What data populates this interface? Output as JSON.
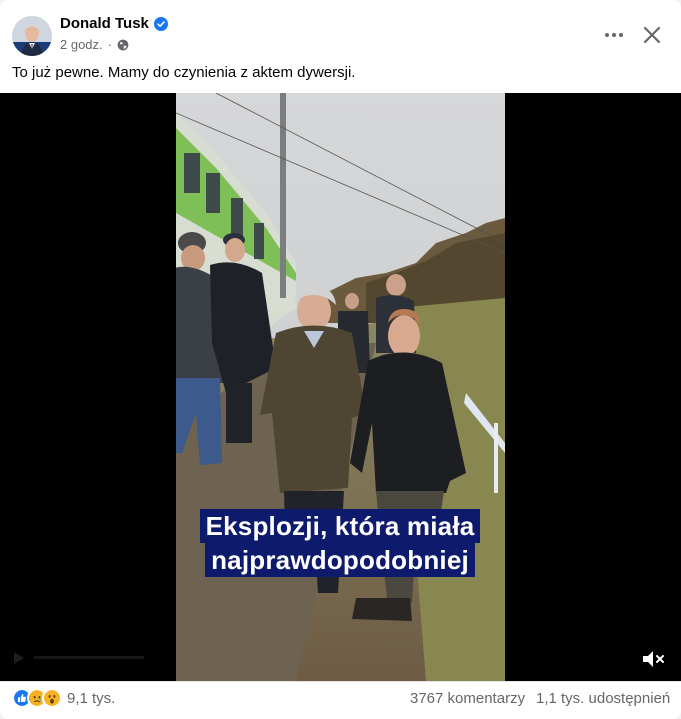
{
  "post": {
    "author": "Donald Tusk",
    "timestamp": "2 godz.",
    "separator": "·",
    "text": "To już pewne. Mamy do czynienia z aktem dywersji."
  },
  "video": {
    "subtitle_line1": "Eksplozji, która miała",
    "subtitle_line2": "najprawdopodobniej",
    "subtitle_bg": "#0e1a6b",
    "muted": true
  },
  "stats": {
    "reactions_count": "9,1 tys.",
    "reactions": [
      "like",
      "sad",
      "wow"
    ],
    "comments": "3767 komentarzy",
    "shares": "1,1 tys. udostępnień"
  },
  "icons": {
    "verified": "verified-badge-icon",
    "audience": "globe-icon",
    "more": "more-dots-icon",
    "close": "close-icon",
    "mute": "speaker-muted-icon"
  },
  "colors": {
    "brand_blue": "#1877f2",
    "meta_gray": "#65676b"
  }
}
